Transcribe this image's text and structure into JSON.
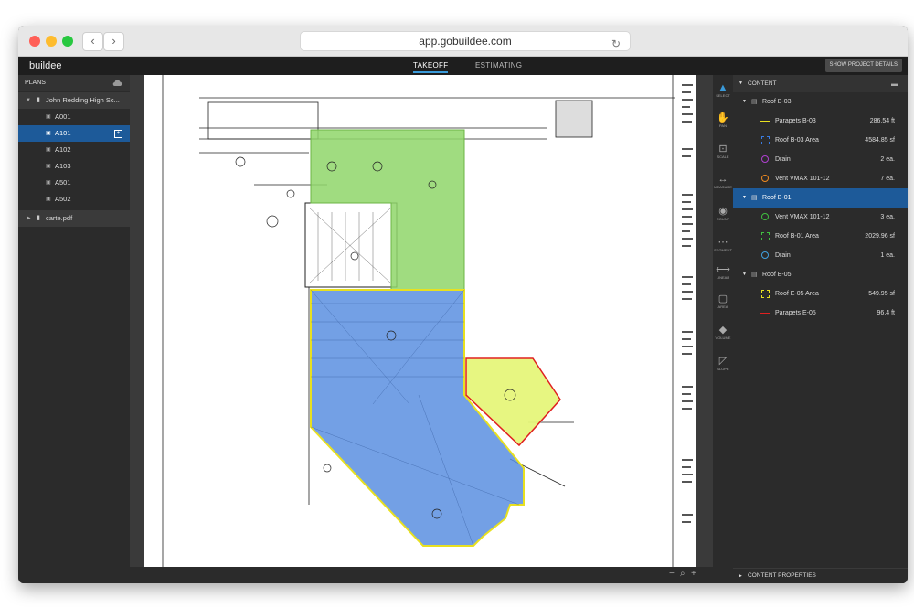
{
  "browser": {
    "url": "app.gobuildee.com",
    "back_glyph": "‹",
    "forward_glyph": "›",
    "reload_glyph": "↻"
  },
  "app": {
    "brand": "buildee",
    "tabs": [
      {
        "label": "TAKEOFF",
        "active": true
      },
      {
        "label": "ESTIMATING",
        "active": false
      }
    ],
    "show_details_label": "SHOW PROJECT DETAILS"
  },
  "plans": {
    "header": "PLANS",
    "project": "John Redding High Sc...",
    "sheets": [
      "A001",
      "A101",
      "A102",
      "A103",
      "A501",
      "A502"
    ],
    "selected_sheet": "A101",
    "other_file": "carte.pdf"
  },
  "tools": {
    "labels": [
      "SELECT",
      "PAN",
      "SCALE",
      "MEASURE",
      "COUNT",
      "SEGMENT",
      "LINEAR",
      "AREA",
      "VOLUME",
      "SLOPE"
    ]
  },
  "content": {
    "header": "CONTENT",
    "groups": [
      {
        "name": "Roof B-03",
        "items": [
          {
            "name": "Parapets B-03",
            "value": "286.54 ft",
            "icon": "linear-icon",
            "color": "#e8e020"
          },
          {
            "name": "Roof B-03 Area",
            "value": "4584.85 sf",
            "icon": "area-icon",
            "color": "#3a7be0"
          },
          {
            "name": "Drain",
            "value": "2 ea.",
            "icon": "count-icon",
            "color": "#b040d0"
          },
          {
            "name": "Vent VMAX 101-12",
            "value": "7 ea.",
            "icon": "count-icon",
            "color": "#f08a20"
          }
        ]
      },
      {
        "name": "Roof B-01",
        "items": [
          {
            "name": "Vent VMAX 101-12",
            "value": "3 ea.",
            "icon": "count-icon",
            "color": "#40c040"
          },
          {
            "name": "Roof B-01 Area",
            "value": "2029.96 sf",
            "icon": "area-icon",
            "color": "#40c040"
          },
          {
            "name": "Drain",
            "value": "1 ea.",
            "icon": "count-icon",
            "color": "#40a0e0"
          }
        ]
      },
      {
        "name": "Roof E-05",
        "items": [
          {
            "name": "Roof E-05 Area",
            "value": "549.95 sf",
            "icon": "area-icon",
            "color": "#e8e020"
          },
          {
            "name": "Parapets E-05",
            "value": "96.4 ft",
            "icon": "linear-icon",
            "color": "#e02020"
          }
        ]
      }
    ],
    "selected_group": "Roof B-01"
  },
  "properties": {
    "header": "CONTENT PROPERTIES"
  },
  "zoom": {
    "minus": "−",
    "search": "⌕",
    "plus": "+"
  },
  "colors": {
    "accent": "#1d5a99",
    "green_area": "#8fd66a",
    "blue_area": "#5b8fe0",
    "yellow_area": "#e6f57a",
    "red_outline": "#e02020"
  }
}
